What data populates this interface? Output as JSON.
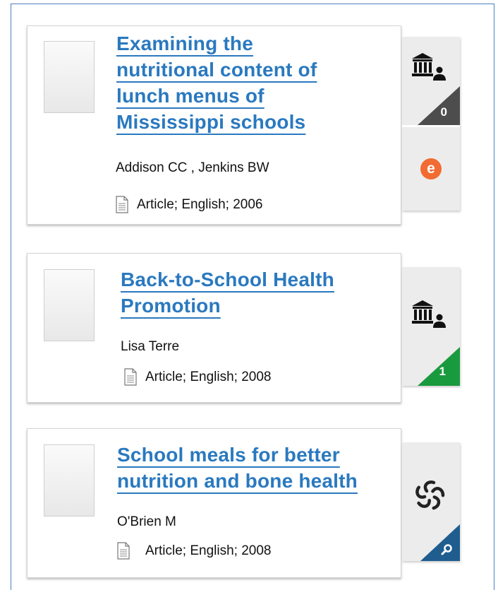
{
  "results": [
    {
      "title_lines": [
        "Examining the",
        "nutritional content of",
        "lunch menus of",
        "Mississippi schools"
      ],
      "authors": "Addison CC , Jenkins BW",
      "meta": "Article; English; 2006",
      "library_count": "0",
      "library_color": "#4d4d4d",
      "has_ebook": true,
      "ebook_label": "e"
    },
    {
      "title_lines": [
        "Back-to-School Health",
        "Promotion"
      ],
      "authors": "Lisa Terre",
      "meta": "Article; English; 2008",
      "library_count": "1",
      "library_color": "#1a9a3e"
    },
    {
      "title_lines": [
        "School meals for better",
        "nutrition and bone health"
      ],
      "authors": "O'Brien M",
      "meta": "Article; English; 2008",
      "search_color": "#1f5d8f"
    }
  ]
}
